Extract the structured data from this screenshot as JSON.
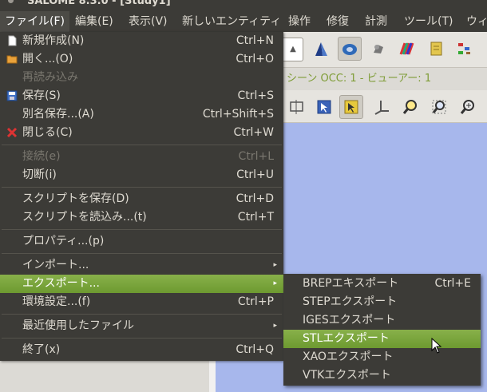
{
  "window": {
    "title": "SALOME 8.3.0 - [Study1]"
  },
  "menubar": {
    "items": [
      {
        "label": "ファイル(F)"
      },
      {
        "label": "編集(E)"
      },
      {
        "label": "表示(V)"
      },
      {
        "label": "新しいエンティティ"
      },
      {
        "label": "操作"
      },
      {
        "label": "修復"
      },
      {
        "label": "計測"
      },
      {
        "label": "ツール(T)"
      },
      {
        "label": "ウィ"
      }
    ]
  },
  "viewer": {
    "title": "シーン OCC: 1 - ビューアー: 1"
  },
  "file_menu": {
    "items": [
      {
        "label": "新規作成(N)",
        "accel": "Ctrl+N",
        "icon": "new-document-icon"
      },
      {
        "label": "開く...(O)",
        "accel": "Ctrl+O",
        "icon": "folder-open-icon"
      },
      {
        "label": "再読み込み",
        "accel": "",
        "disabled": true
      },
      {
        "label": "保存(S)",
        "accel": "Ctrl+S",
        "icon": "save-icon"
      },
      {
        "label": "別名保存...(A)",
        "accel": "Ctrl+Shift+S"
      },
      {
        "label": "閉じる(C)",
        "accel": "Ctrl+W",
        "icon": "close-icon"
      },
      {
        "label": "接続(e)",
        "accel": "Ctrl+L",
        "disabled": true
      },
      {
        "label": "切断(i)",
        "accel": "Ctrl+U"
      },
      {
        "label": "スクリプトを保存(D)",
        "accel": "Ctrl+D"
      },
      {
        "label": "スクリプトを読込み...(t)",
        "accel": "Ctrl+T"
      },
      {
        "label": "プロパティ...(p)",
        "accel": ""
      },
      {
        "label": "インポート...",
        "accel": "",
        "submenu": true
      },
      {
        "label": "エクスポート...",
        "accel": "",
        "submenu": true,
        "highlighted": true
      },
      {
        "label": "環境設定...(f)",
        "accel": "Ctrl+P"
      },
      {
        "label": "最近使用したファイル",
        "accel": "",
        "submenu": true
      },
      {
        "label": "終了(x)",
        "accel": "Ctrl+Q"
      }
    ]
  },
  "export_submenu": {
    "items": [
      {
        "label": "BREPエキスポート",
        "accel": "Ctrl+E"
      },
      {
        "label": "STEPエクスポート",
        "accel": ""
      },
      {
        "label": "IGESエクスポート",
        "accel": ""
      },
      {
        "label": "STLエクスポート",
        "accel": "",
        "highlighted": true
      },
      {
        "label": "XAOエクスポート",
        "accel": ""
      },
      {
        "label": "VTKエクスポート",
        "accel": ""
      }
    ]
  },
  "colors": {
    "menu_bg": "#3c3b37",
    "highlight": "#7aa53d",
    "viewport": "#a7b7ec",
    "viewer_title": "#7e9c36"
  }
}
